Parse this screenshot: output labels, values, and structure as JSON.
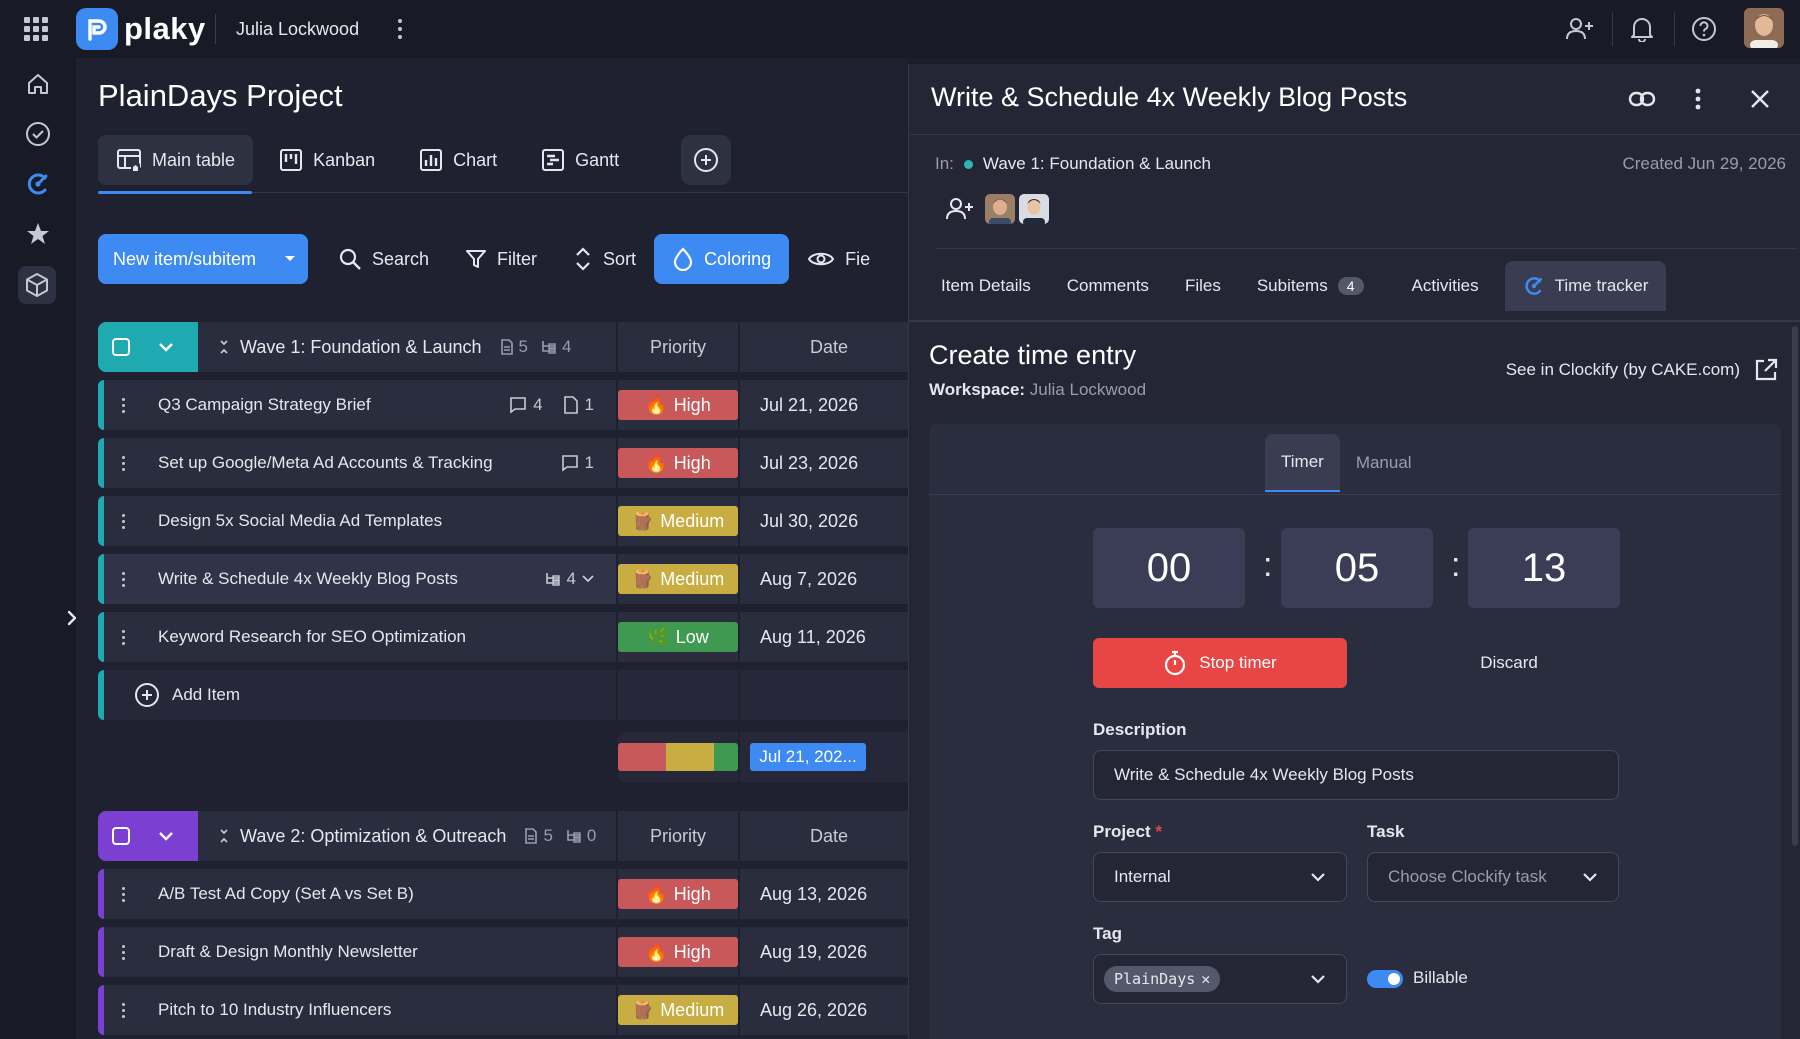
{
  "topbar": {
    "logo_text": "plaky",
    "workspace_name": "Julia Lockwood",
    "icons": [
      "apps-grid-icon",
      "add-user-icon",
      "bell-icon",
      "help-icon"
    ]
  },
  "sidebar": {
    "icons": [
      "home-icon",
      "check-circle-icon",
      "clockify-icon",
      "star-icon",
      "cube-icon"
    ]
  },
  "project": {
    "title": "PlainDays Project",
    "views": [
      {
        "label": "Main table",
        "icon": "table-icon"
      },
      {
        "label": "Kanban",
        "icon": "kanban-icon"
      },
      {
        "label": "Chart",
        "icon": "chart-icon"
      },
      {
        "label": "Gantt",
        "icon": "gantt-icon"
      }
    ]
  },
  "toolbar": {
    "new_item": "New item/subitem",
    "search": "Search",
    "filter": "Filter",
    "sort": "Sort",
    "coloring": "Coloring",
    "fields": "Fie"
  },
  "groups": [
    {
      "title": "Wave 1: Foundation & Launch",
      "color": "#1fa9b0",
      "item_count": "5",
      "subitem_count": "4",
      "columns": {
        "priority": "Priority",
        "date": "Date"
      },
      "rows": [
        {
          "name": "Q3 Campaign Strategy Brief",
          "comments": "4",
          "files": "1",
          "priority": "High",
          "date": "Jul 21, 2026"
        },
        {
          "name": "Set up Google/Meta Ad Accounts & Tracking",
          "comments": "1",
          "priority": "High",
          "date": "Jul 23, 2026"
        },
        {
          "name": "Design 5x Social Media Ad Templates",
          "priority": "Medium",
          "date": "Jul 30, 2026"
        },
        {
          "name": "Write & Schedule 4x Weekly Blog Posts",
          "subitems": "4",
          "priority": "Medium",
          "date": "Aug 7, 2026"
        },
        {
          "name": "Keyword Research for SEO Optimization",
          "priority": "Low",
          "date": "Aug 11, 2026"
        }
      ],
      "add_item": "Add Item",
      "summary_date": "Jul 21, 202..."
    },
    {
      "title": "Wave 2: Optimization & Outreach",
      "color": "#7b3fd1",
      "item_count": "5",
      "subitem_count": "0",
      "columns": {
        "priority": "Priority",
        "date": "Date"
      },
      "rows": [
        {
          "name": "A/B Test Ad Copy (Set A vs Set B)",
          "priority": "High",
          "date": "Aug 13, 2026"
        },
        {
          "name": "Draft & Design Monthly Newsletter",
          "priority": "High",
          "date": "Aug 19, 2026"
        },
        {
          "name": "Pitch to 10 Industry Influencers",
          "priority": "Medium",
          "date": "Aug 26, 2026"
        }
      ]
    }
  ],
  "priority_colors": {
    "High": "#c9585a",
    "Medium": "#c8ad42",
    "Low": "#3f9950"
  },
  "panel": {
    "title": "Write & Schedule 4x Weekly Blog Posts",
    "in_label": "In:",
    "group": "Wave 1: Foundation & Launch",
    "created": "Created Jun 29, 2026",
    "tabs": [
      {
        "label": "Item Details"
      },
      {
        "label": "Comments"
      },
      {
        "label": "Files"
      },
      {
        "label": "Subitems",
        "badge": "4"
      },
      {
        "label": "Activities"
      },
      {
        "label": "Time tracker"
      }
    ],
    "time_entry": {
      "title": "Create time entry",
      "workspace_label": "Workspace:",
      "workspace_value": "Julia Lockwood",
      "clockify_link": "See in Clockify (by CAKE.com)",
      "modes": [
        "Timer",
        "Manual"
      ],
      "hours": "00",
      "minutes": "05",
      "seconds": "13",
      "colon": ":",
      "stop_label": "Stop timer",
      "discard_label": "Discard",
      "description_label": "Description",
      "description_value": "Write & Schedule 4x Weekly Blog Posts",
      "project_label": "Project",
      "project_required": "*",
      "project_value": "Internal",
      "task_label": "Task",
      "task_placeholder": "Choose Clockify task",
      "tag_label": "Tag",
      "tag_chip": "PlainDays",
      "tag_chip_remove": "✕",
      "billable_label": "Billable",
      "billable_on": true
    }
  },
  "accent_color": "#3d8bf2",
  "danger_color": "#e84545"
}
